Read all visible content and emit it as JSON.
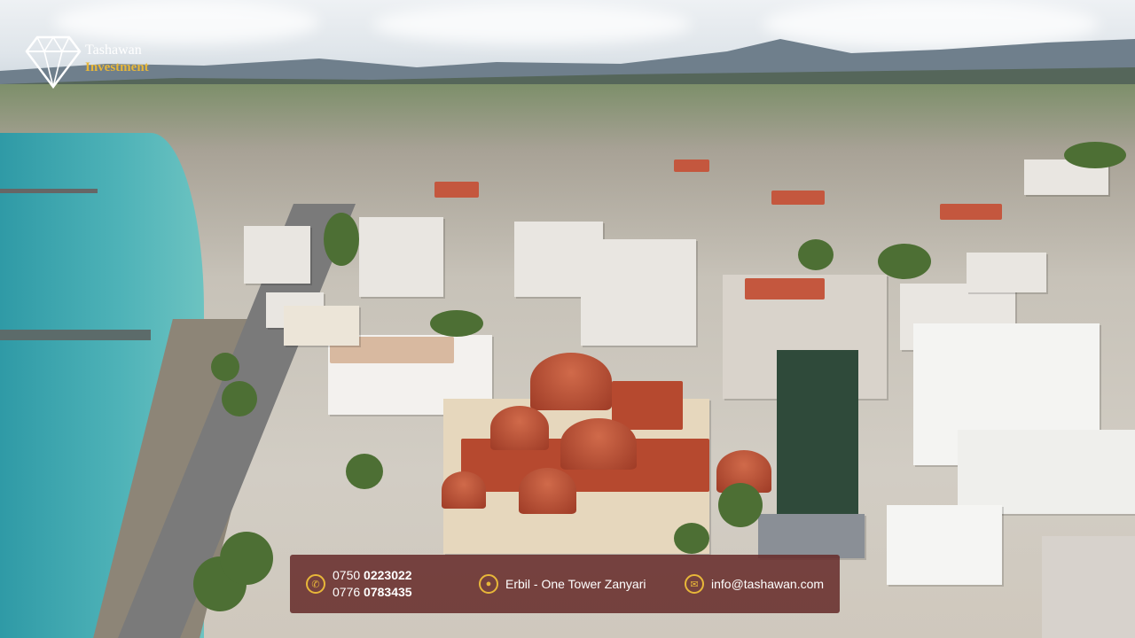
{
  "brand": {
    "name": "Tashawan",
    "sub": "Investment",
    "icon": "diamond-icon",
    "colors": {
      "name": "#ffffff",
      "sub": "#e8b739"
    }
  },
  "contact": {
    "phones": [
      {
        "prefix": "0750",
        "number": "0223022"
      },
      {
        "prefix": "0776",
        "number": "0783435"
      }
    ],
    "location": "Erbil - One Tower Zanyari",
    "email": "info@tashawan.com",
    "icons": [
      "phone-icon",
      "location-pin-icon",
      "email-icon"
    ],
    "bar_color": "#682e2c",
    "accent": "#e8b739"
  }
}
